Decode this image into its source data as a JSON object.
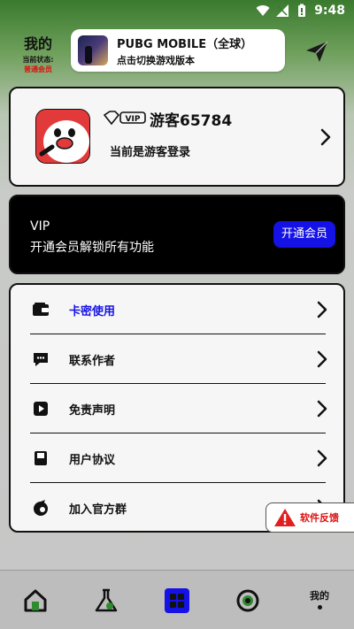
{
  "status_bar": {
    "time": "9:48"
  },
  "header": {
    "title": "我的",
    "status_label": "当前状态:",
    "member_level": "普通会员"
  },
  "game_selector": {
    "game_name": "PUBG MOBILE（全球）",
    "hint": "点击切换游戏版本"
  },
  "profile": {
    "vip_badge": "VIP",
    "username": "游客65784",
    "login_status": "当前是游客登录"
  },
  "vip_promo": {
    "title": "VIP",
    "description": "开通会员解锁所有功能",
    "button_label": "开通会员"
  },
  "menu": {
    "items": [
      {
        "label": "卡密使用",
        "icon": "wallet-icon",
        "active": true
      },
      {
        "label": "联系作者",
        "icon": "chat-icon",
        "active": false
      },
      {
        "label": "免责声明",
        "icon": "play-doc-icon",
        "active": false
      },
      {
        "label": "用户协议",
        "icon": "book-icon",
        "active": false
      },
      {
        "label": "加入官方群",
        "icon": "group-icon",
        "active": false
      }
    ]
  },
  "feedback": {
    "label": "软件反馈",
    "icon": "warning-icon"
  },
  "bottom_nav": {
    "items": [
      "home-icon",
      "flask-icon",
      "apps-icon",
      "compass-icon"
    ],
    "mine_label": "我的"
  },
  "colors": {
    "accent_blue": "#1512e6",
    "member_red": "#dd1111"
  }
}
